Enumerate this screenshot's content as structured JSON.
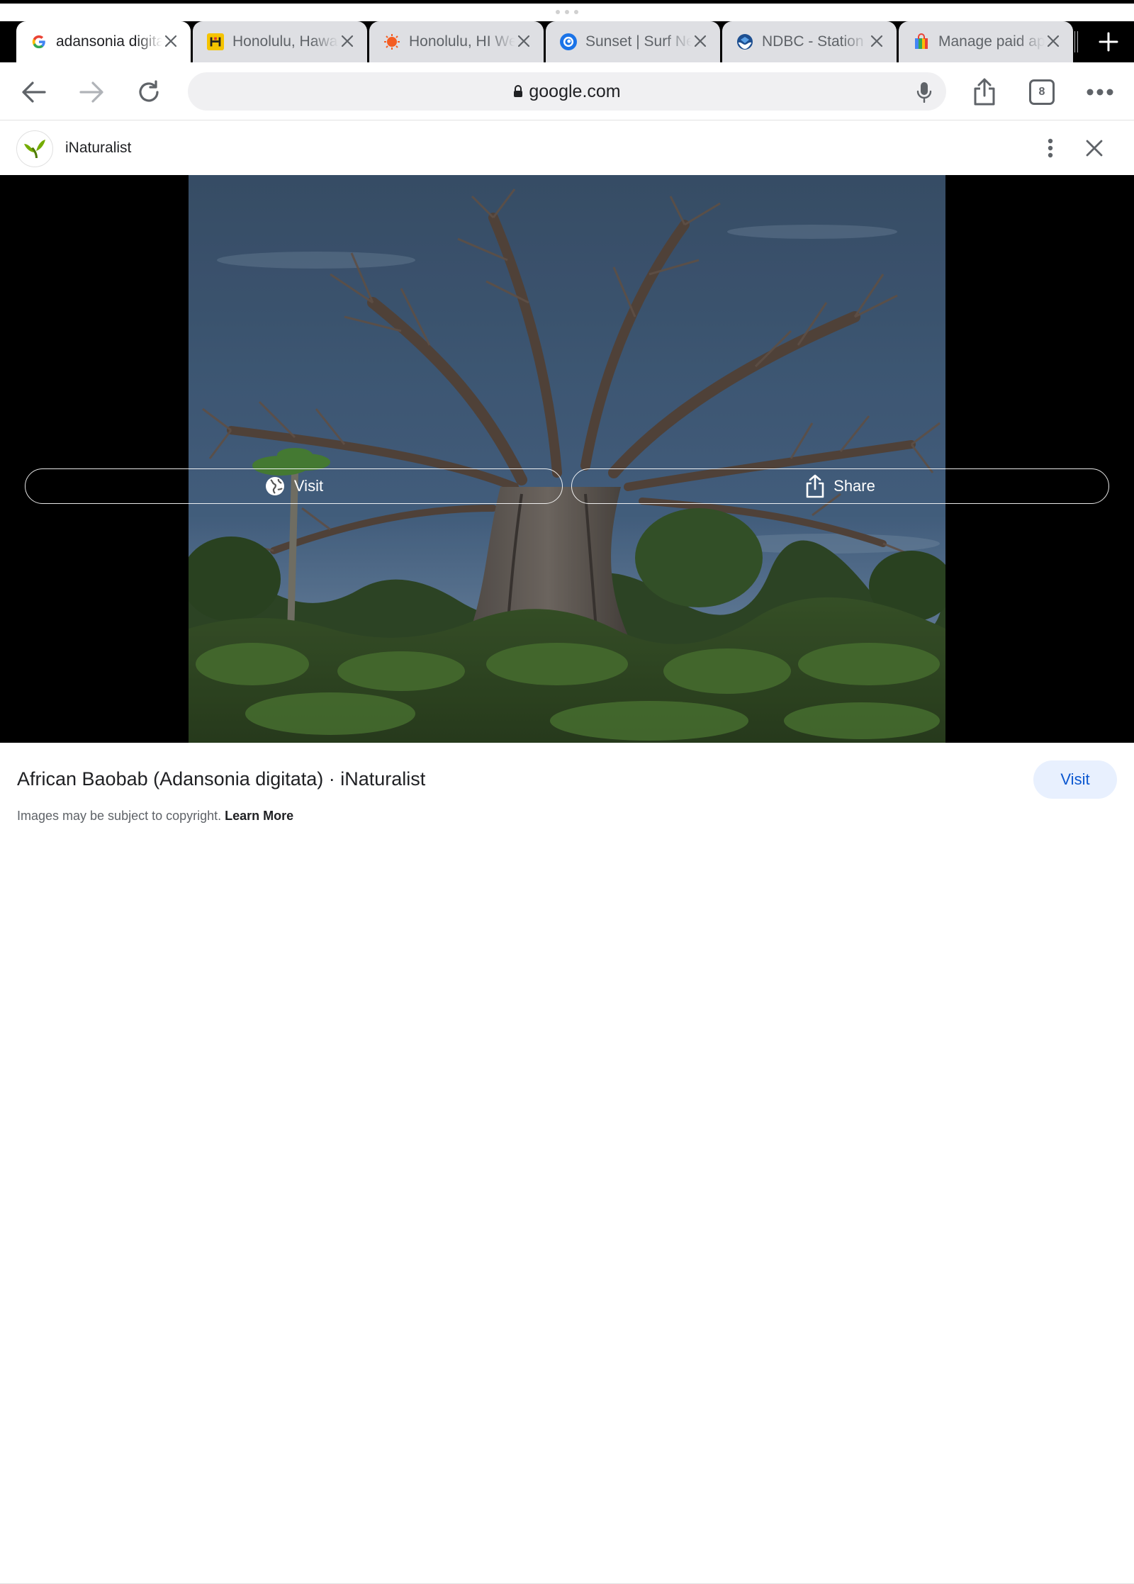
{
  "browser": {
    "tabs": [
      {
        "title": "adansonia digitata - Google Search",
        "favicon": "google-g-icon",
        "active": true
      },
      {
        "title": "Honolulu, Hawaii",
        "favicon": "yellow-h-icon",
        "active": false
      },
      {
        "title": "Honolulu, HI Weather",
        "favicon": "orange-sun-icon",
        "active": false
      },
      {
        "title": "Sunset | Surf News",
        "favicon": "blue-wave-icon",
        "active": false
      },
      {
        "title": "NDBC - Station",
        "favicon": "noaa-icon",
        "active": false
      },
      {
        "title": "Manage paid apps",
        "favicon": "shopping-bag-icon",
        "active": false
      }
    ],
    "address_bar": {
      "url": "google.com",
      "secure": true
    },
    "tab_count": "8"
  },
  "viewer": {
    "site_name": "iNaturalist",
    "visit_label": "Visit",
    "share_label": "Share"
  },
  "caption": {
    "title": "African Baobab (Adansonia digitata) · iNaturalist",
    "visit_button": "Visit",
    "copyright_text": "Images may be subject to copyright.",
    "learn_more": "Learn More"
  },
  "colors": {
    "accent_blue": "#0b57d0",
    "visit_button_bg": "#e8f0fe",
    "tab_strip_bg": "#000000",
    "inactive_tab_bg": "#dedfe3"
  }
}
